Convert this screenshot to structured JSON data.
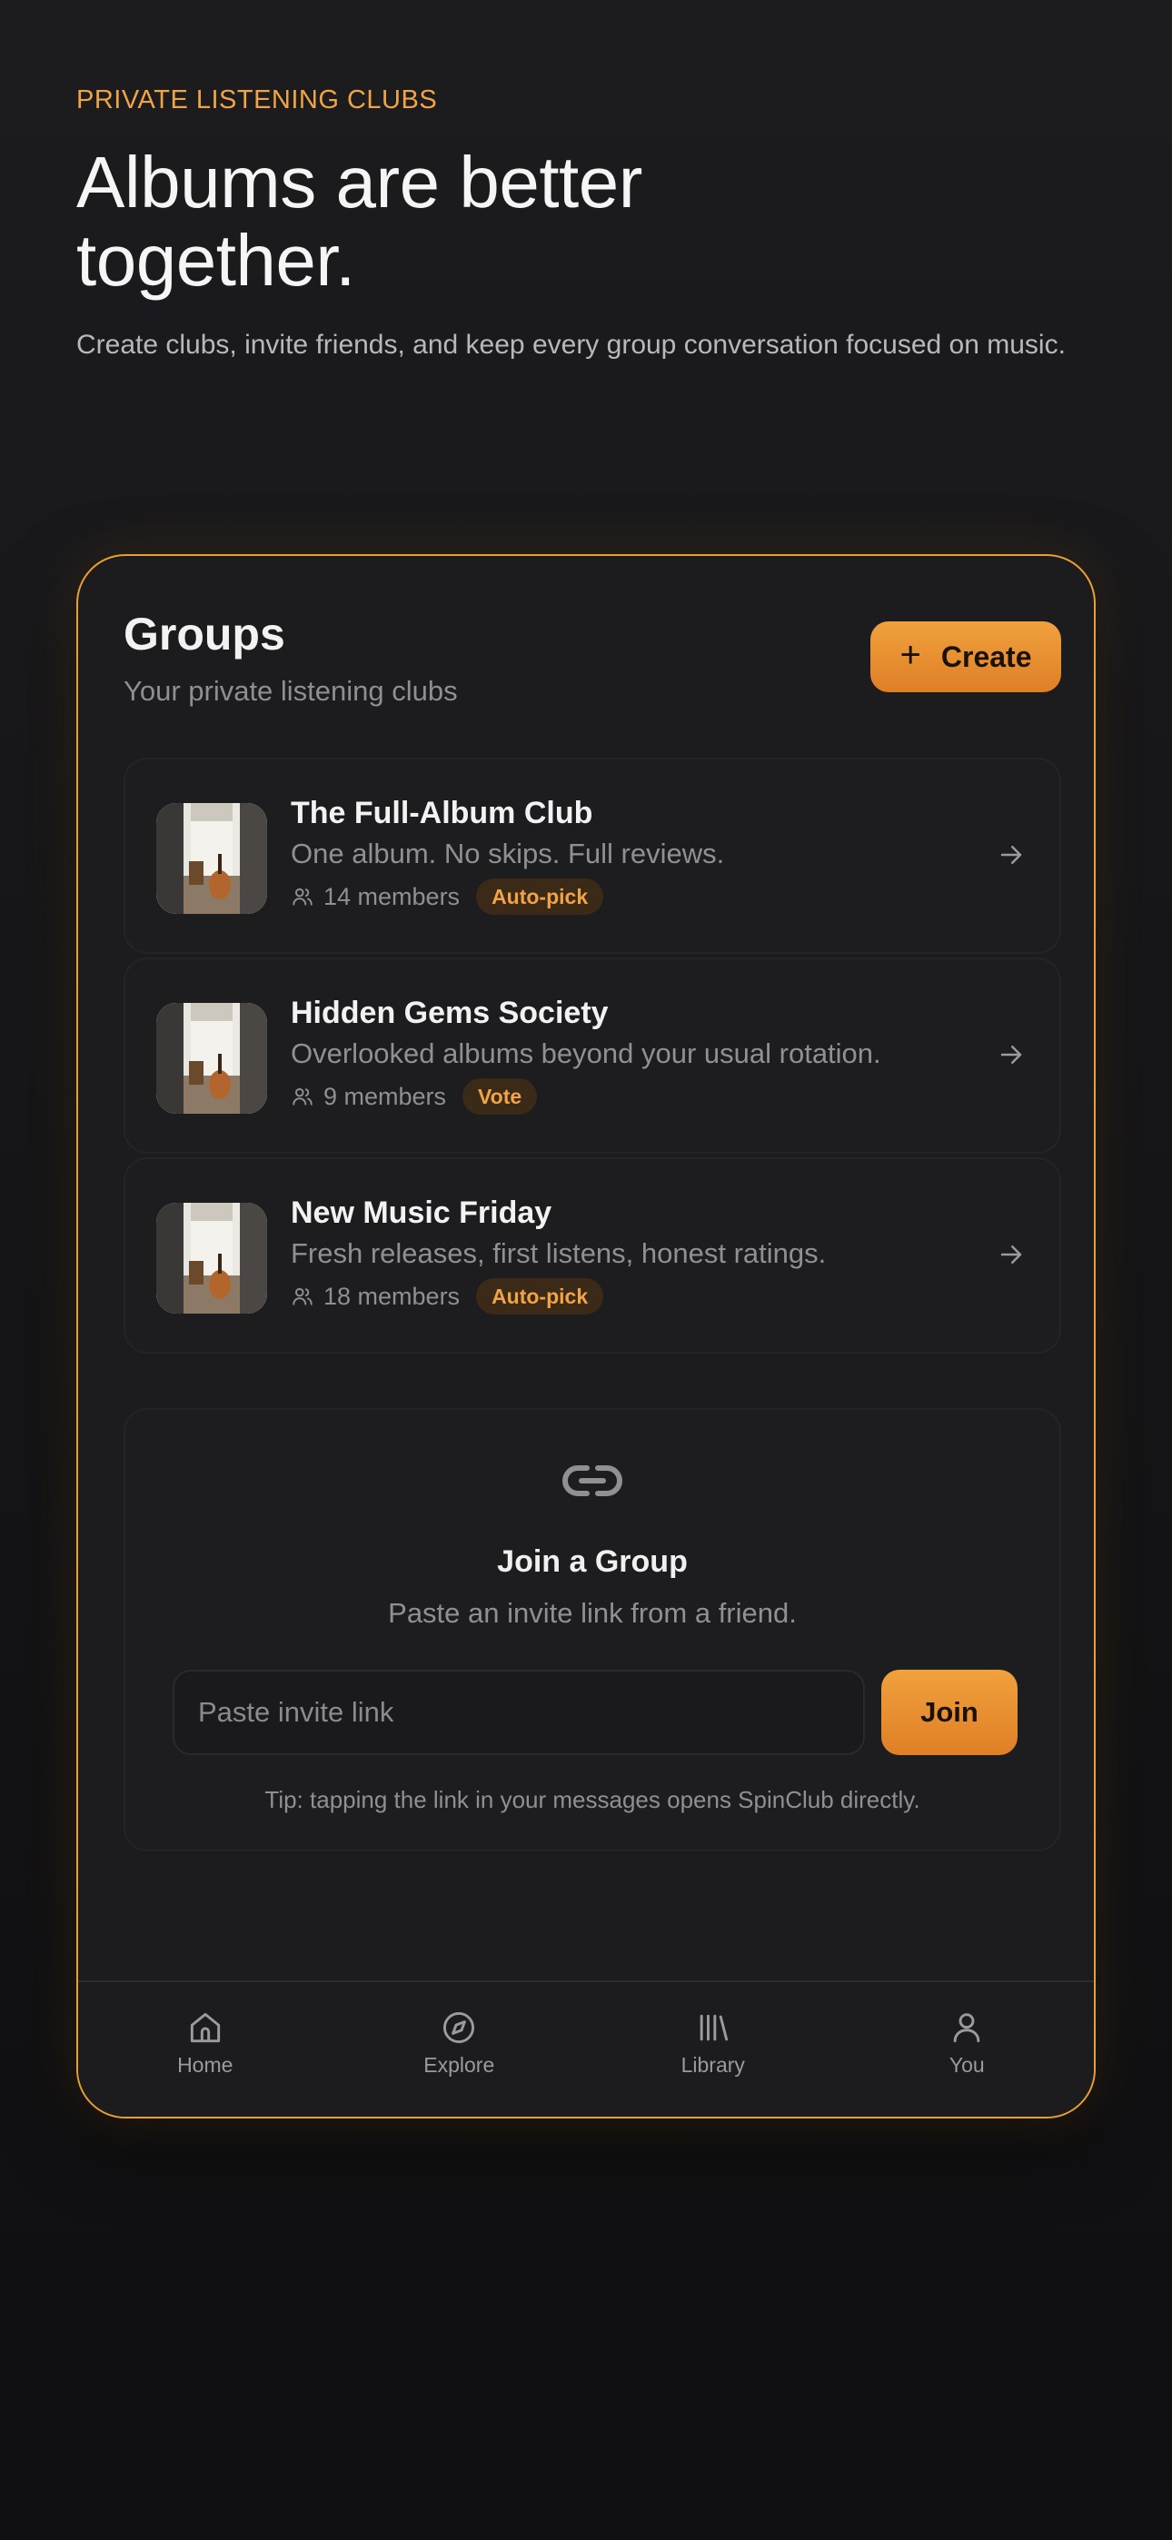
{
  "hero": {
    "eyebrow": "PRIVATE LISTENING CLUBS",
    "title": "Albums are better together.",
    "subtitle": "Create clubs, invite friends, and keep every group conversation focused on music."
  },
  "groups": {
    "title": "Groups",
    "subtitle": "Your private listening clubs",
    "create_label": "Create",
    "items": [
      {
        "name": "The Full-Album Club",
        "description": "One album. No skips. Full reviews.",
        "members": "14 members",
        "badge": "Auto-pick"
      },
      {
        "name": "Hidden Gems Society",
        "description": "Overlooked albums beyond your usual rotation.",
        "members": "9 members",
        "badge": "Vote"
      },
      {
        "name": "New Music Friday",
        "description": "Fresh releases, first listens, honest ratings.",
        "members": "18 members",
        "badge": "Auto-pick"
      }
    ]
  },
  "join": {
    "title": "Join a Group",
    "subtitle": "Paste an invite link from a friend.",
    "input_placeholder": "Paste invite link",
    "input_value": "",
    "button_label": "Join",
    "tip": "Tip: tapping the link in your messages opens SpinClub directly."
  },
  "nav": {
    "items": [
      {
        "label": "Home",
        "icon": "home-icon"
      },
      {
        "label": "Explore",
        "icon": "compass-icon"
      },
      {
        "label": "Library",
        "icon": "library-icon"
      },
      {
        "label": "You",
        "icon": "user-icon"
      }
    ]
  },
  "colors": {
    "accent": "#f0a13d",
    "accent_dark": "#df7f26",
    "background": "#1c1c1e",
    "badge_bg": "#3a2a17"
  }
}
